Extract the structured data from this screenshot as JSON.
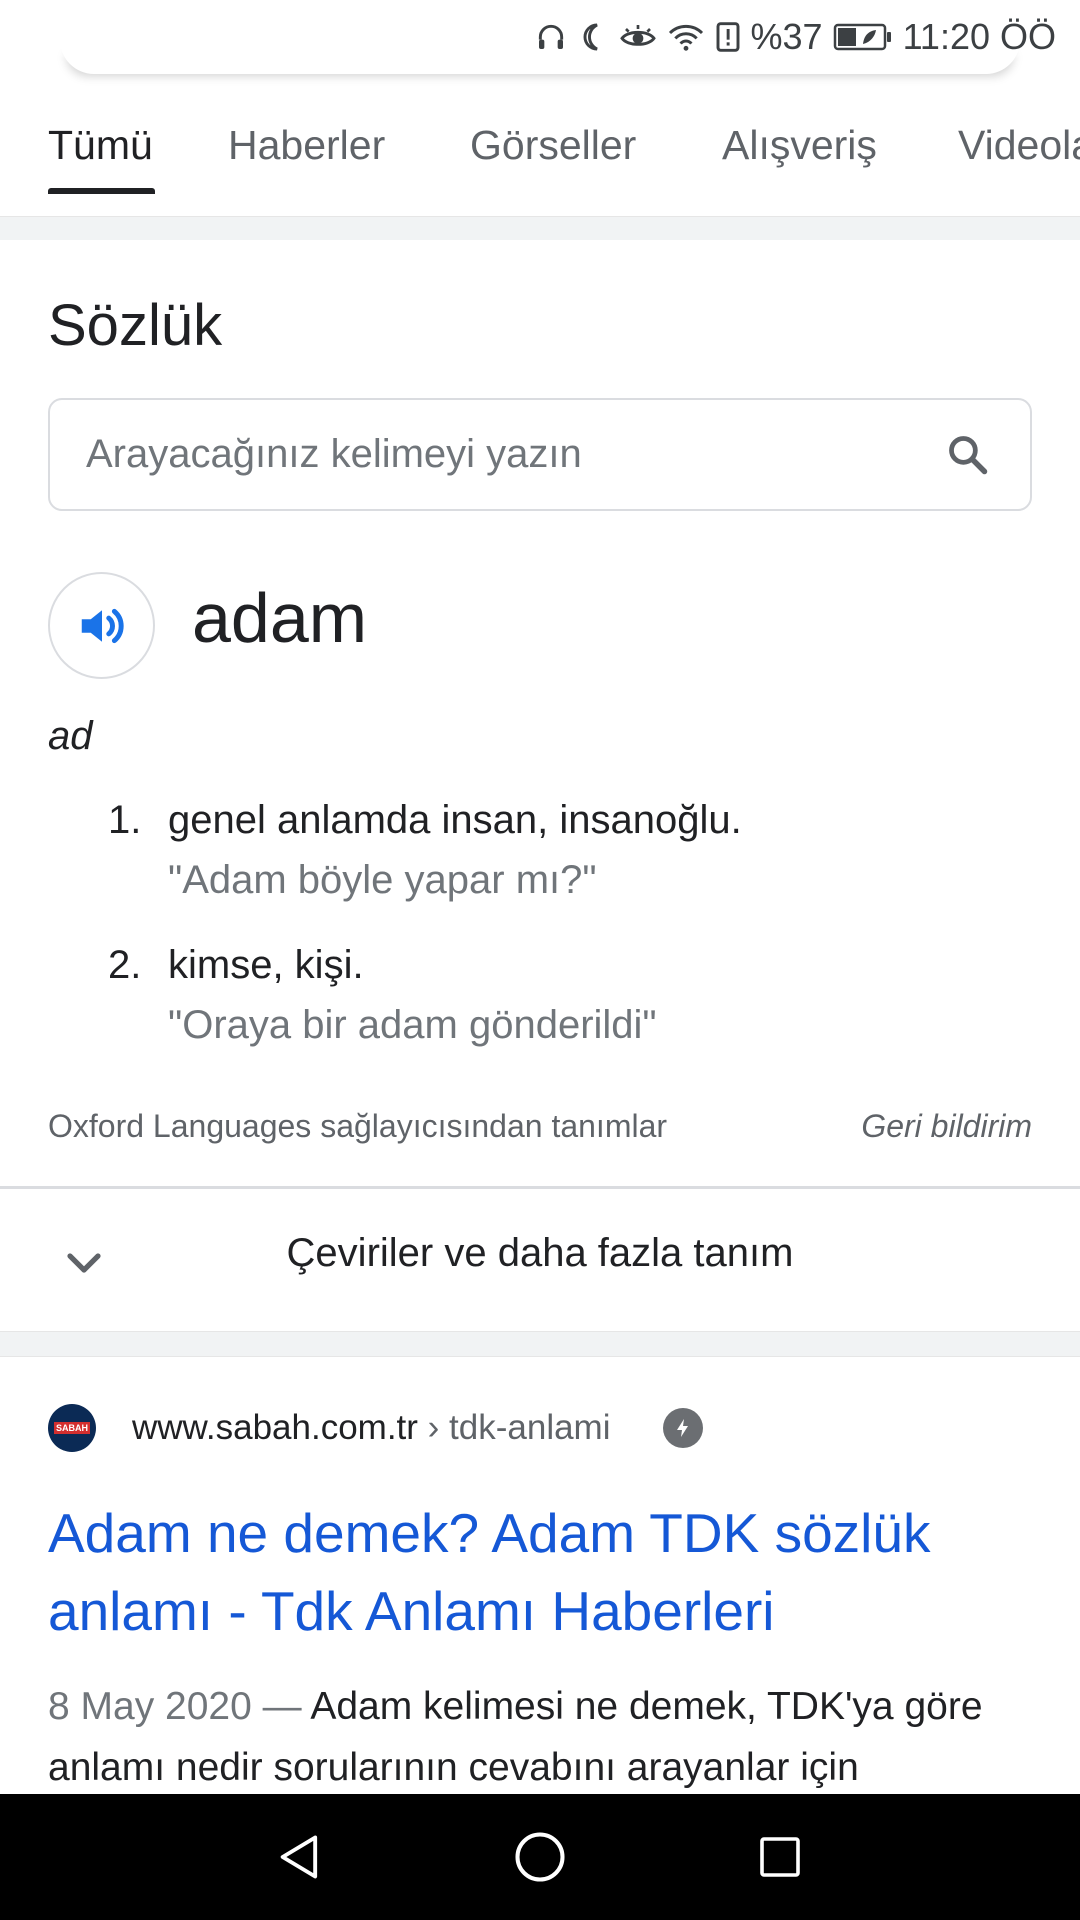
{
  "status_bar": {
    "battery_percent": "%37",
    "time": "11:20 ÖÖ",
    "icons": [
      "headphones-icon",
      "moon-icon",
      "eye-icon",
      "wifi-icon",
      "alert-icon",
      "battery-icon"
    ]
  },
  "tabs": [
    {
      "label": "Tümü",
      "active": true
    },
    {
      "label": "Haberler",
      "active": false
    },
    {
      "label": "Görseller",
      "active": false
    },
    {
      "label": "Alışveriş",
      "active": false
    },
    {
      "label": "Videolar",
      "active": false
    }
  ],
  "dictionary": {
    "title": "Sözlük",
    "search_placeholder": "Arayacağınız kelimeyi yazın",
    "word": "adam",
    "part_of_speech": "ad",
    "definitions": [
      {
        "number": "1.",
        "text": "genel anlamda insan, insanoğlu.",
        "example": "\"Adam böyle yapar mı?\""
      },
      {
        "number": "2.",
        "text": "kimse, kişi.",
        "example": "\"Oraya bir adam gönderildi\""
      }
    ],
    "source": "Oxford Languages sağlayıcısından tanımlar",
    "feedback": "Geri bildirim",
    "expand_label": "Çeviriler ve daha fazla tanım"
  },
  "result": {
    "favicon_text": "SABAH",
    "domain": "www.sabah.com.tr",
    "breadcrumb": " › tdk-anlami",
    "title": "Adam ne demek? Adam TDK sözlük anlamı - Tdk Anlamı Haberleri",
    "date": "8 May 2020 — ",
    "snippet": "Adam kelimesi ne demek, TDK'ya göre anlamı nedir sorularının cevabını arayanlar için"
  },
  "colors": {
    "accent_blue": "#1a73e8",
    "link_blue": "#1558d6",
    "text": "#202124",
    "muted": "#70757a"
  }
}
